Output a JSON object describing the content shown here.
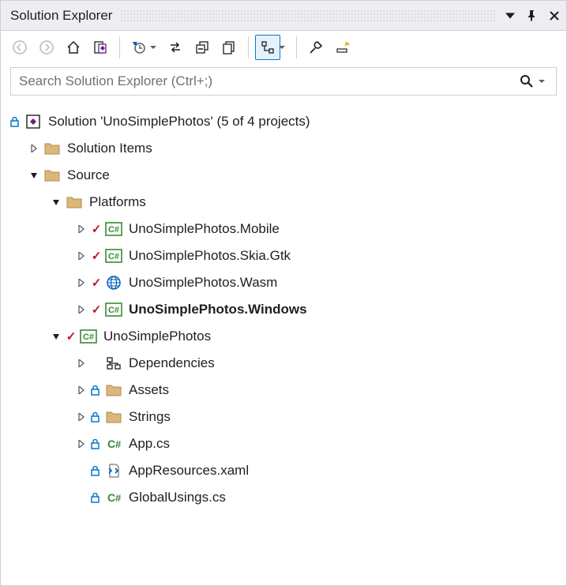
{
  "panel": {
    "title": "Solution Explorer"
  },
  "search": {
    "placeholder": "Search Solution Explorer (Ctrl+;)"
  },
  "tree": {
    "solution_label": "Solution 'UnoSimplePhotos' (5 of 4 projects)",
    "solution_items": "Solution Items",
    "source": "Source",
    "platforms": "Platforms",
    "mobile": "UnoSimplePhotos.Mobile",
    "skia": "UnoSimplePhotos.Skia.Gtk",
    "wasm": "UnoSimplePhotos.Wasm",
    "windows": "UnoSimplePhotos.Windows",
    "uno": "UnoSimplePhotos",
    "deps": "Dependencies",
    "assets": "Assets",
    "strings": "Strings",
    "appcs": "App.cs",
    "appxaml": "AppResources.xaml",
    "global": "GlobalUsings.cs"
  }
}
